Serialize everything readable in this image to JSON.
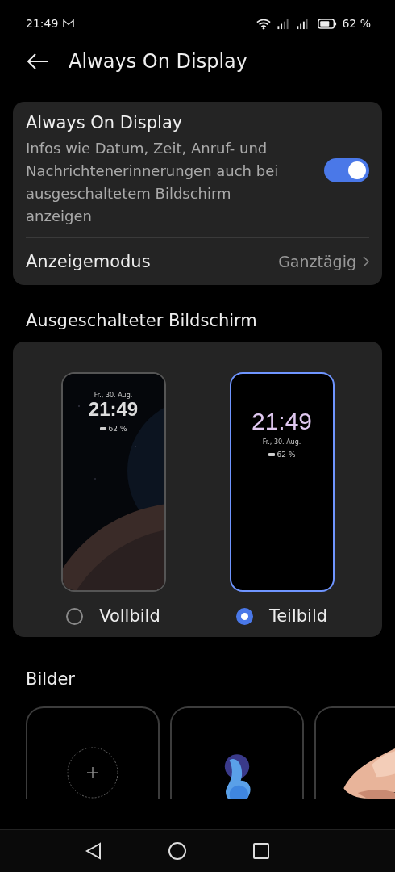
{
  "status_bar": {
    "time": "21:49",
    "battery": "62 %"
  },
  "header": {
    "title": "Always On Display"
  },
  "main_card": {
    "title": "Always On Display",
    "description": "Infos wie Datum, Zeit, Anruf- und Nachrichtenerinnerungen auch bei ausgeschaltetem Bildschirm anzeigen",
    "toggle_on": true,
    "mode_label": "Anzeigemodus",
    "mode_value": "Ganztägig"
  },
  "section_title": "Ausgeschalteter Bildschirm",
  "options": [
    {
      "label": "Vollbild",
      "selected": false,
      "kind": "wallpaper",
      "date": "Fr., 30. Aug.",
      "time": "21:49",
      "battery": "62 %"
    },
    {
      "label": "Teilbild",
      "selected": true,
      "kind": "plain",
      "date": "Fr., 30. Aug.",
      "time": "21:49",
      "battery": "62 %"
    }
  ],
  "images_title": "Bilder",
  "tiles": [
    {
      "kind": "add"
    },
    {
      "kind": "picture"
    },
    {
      "kind": "picture"
    }
  ]
}
